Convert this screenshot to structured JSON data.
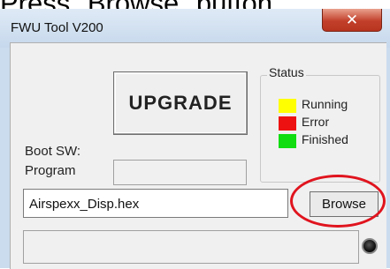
{
  "caption": "Press \"Browse\" button",
  "window": {
    "title": "FWU Tool V200",
    "close_glyph": "✕"
  },
  "buttons": {
    "upgrade": "UPGRADE",
    "browse": "Browse"
  },
  "labels": {
    "boot_sw": "Boot SW:",
    "program": "Program"
  },
  "status": {
    "title": "Status",
    "items": [
      {
        "label": "Running",
        "color": "#ffff00"
      },
      {
        "label": "Error",
        "color": "#ee1111"
      },
      {
        "label": "Finished",
        "color": "#11dd11"
      }
    ]
  },
  "file": {
    "value": "Airspexx_Disp.hex"
  },
  "colors": {
    "highlight_ring": "#e0141e",
    "close_button": "#c2402b"
  },
  "icons": {
    "indicator": "led-indicator-icon"
  }
}
